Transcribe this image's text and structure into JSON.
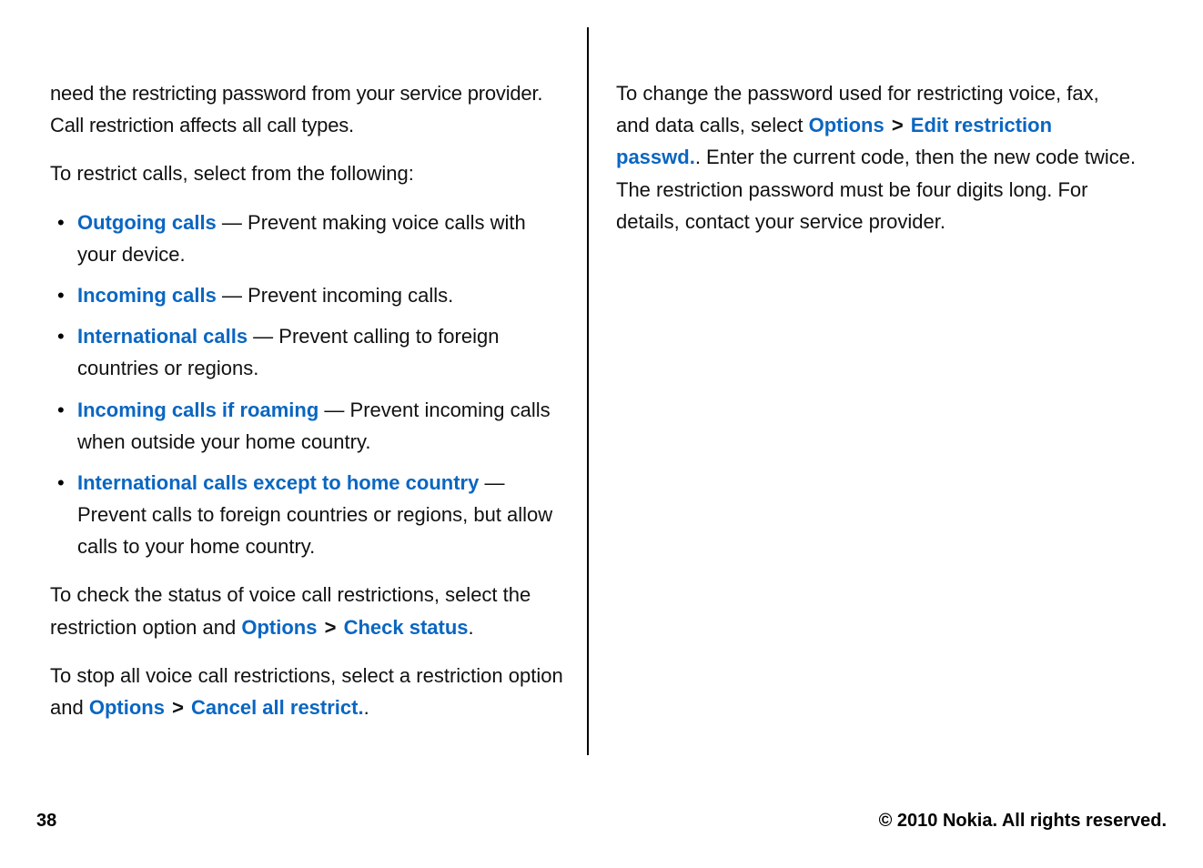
{
  "left": {
    "p1": "need the restricting password from your service provider. Call restriction affects all call types.",
    "p2": "To restrict calls, select from the following:",
    "items": [
      {
        "label": "Outgoing calls",
        "dash": " — ",
        "desc": "Prevent making voice calls with your device."
      },
      {
        "label": "Incoming calls",
        "dash": " — ",
        "desc": "Prevent incoming calls."
      },
      {
        "label": "International calls",
        "dash": " — ",
        "desc": "Prevent calling to foreign countries or regions."
      },
      {
        "label": "Incoming calls if roaming",
        "dash": " — ",
        "desc": "Prevent incoming calls when outside your home country."
      },
      {
        "label": "International calls except to home country",
        "dash": " — ",
        "desc": "Prevent calls to foreign countries or regions, but allow calls to your home country."
      }
    ],
    "p3_a": "To check the status of voice call restrictions, select the restriction option and ",
    "p3_opt1": "Options",
    "p3_gt": ">",
    "p3_opt2": "Check status",
    "p3_end": ".",
    "p4_a": "To stop all voice call restrictions, select a restriction option and ",
    "p4_opt1": "Options",
    "p4_gt": ">",
    "p4_opt2": "Cancel all restrict.",
    "p4_end": "."
  },
  "right": {
    "p1_a": "To change the password used for restricting voice, fax, and data calls, select ",
    "p1_opt1": "Options",
    "p1_gt": ">",
    "p1_opt2": "Edit restriction passwd.",
    "p1_b": ". Enter the current code, then the new code twice. The restriction password must be four digits long. For details, contact your service provider."
  },
  "footer": {
    "page": "38",
    "copyright": "© 2010 Nokia. All rights reserved."
  }
}
